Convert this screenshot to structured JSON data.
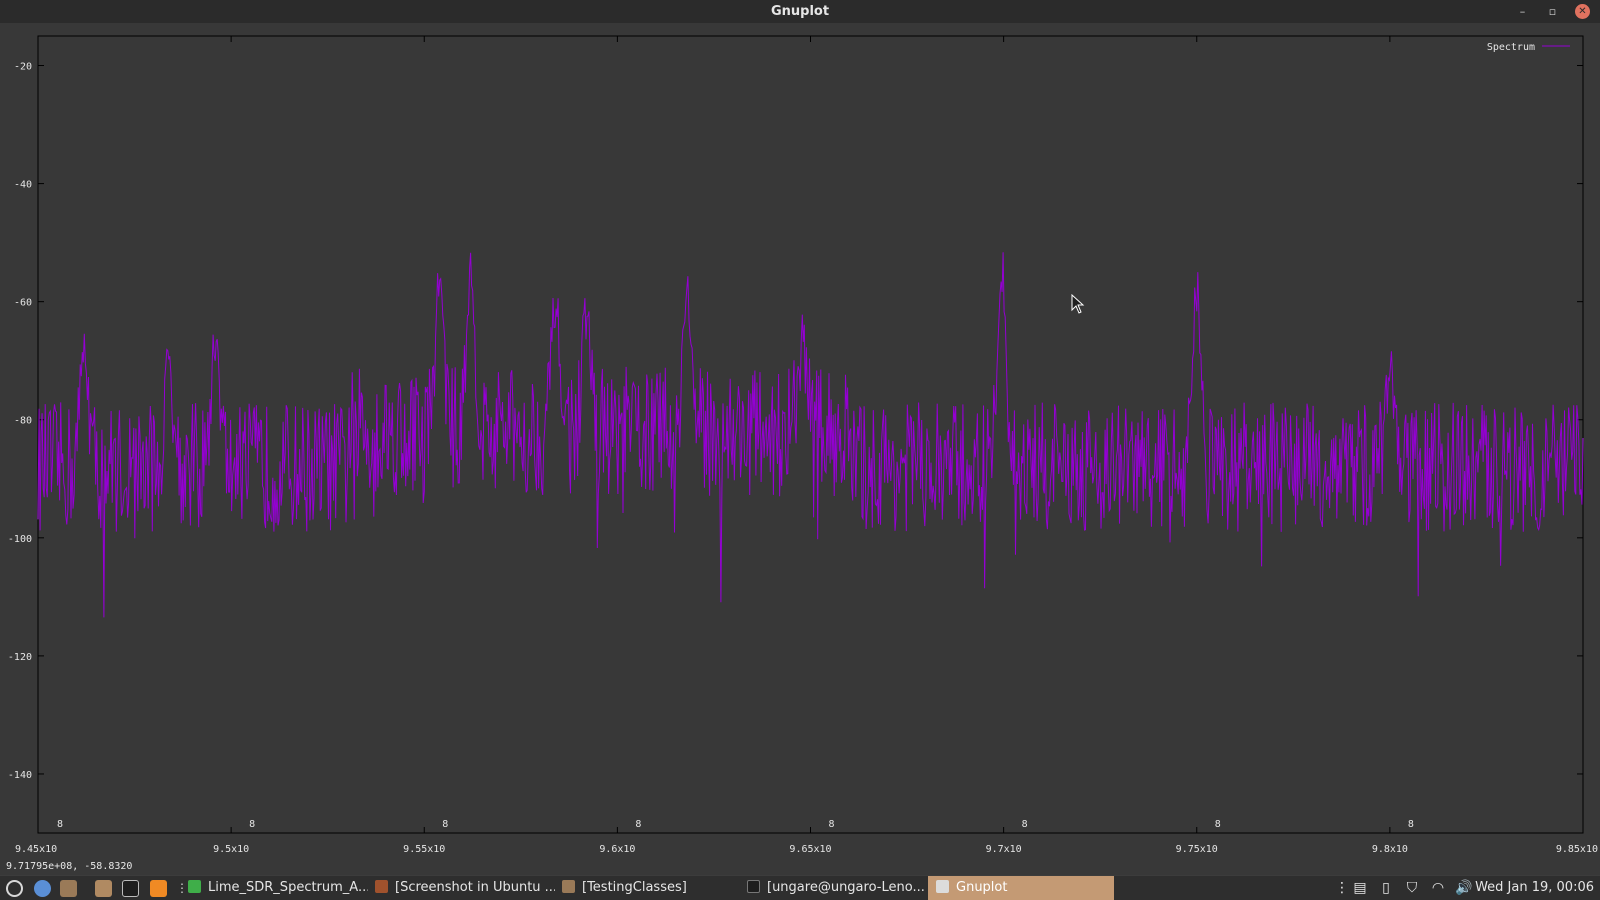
{
  "window": {
    "title": "Gnuplot"
  },
  "plot": {
    "y_ticks": [
      "-20",
      "-40",
      "-60",
      "-80",
      "-100",
      "-120",
      "-140"
    ],
    "x_ticks": [
      "9.45x10",
      "9.5x10",
      "9.55x10",
      "9.6x10",
      "9.65x10",
      "9.7x10",
      "9.75x10",
      "9.8x10",
      "9.85x10"
    ],
    "x_exponent": "8",
    "legend_label": "Spectrum",
    "series_color": "#9400d3",
    "status_text": "9.71795e+08, -58.8320"
  },
  "chart_data": {
    "type": "line",
    "legend": "top-right",
    "grid": false,
    "xlim": [
      945000000,
      985000000
    ],
    "ylim": [
      -150,
      -15
    ],
    "series": [
      {
        "name": "Spectrum",
        "color": "#9400d3",
        "noise_floor": -88,
        "peaks": [
          {
            "x": 946200000,
            "y": -68
          },
          {
            "x": 948400000,
            "y": -70
          },
          {
            "x": 949600000,
            "y": -66
          },
          {
            "x": 955400000,
            "y": -56
          },
          {
            "x": 956200000,
            "y": -56
          },
          {
            "x": 958400000,
            "y": -60
          },
          {
            "x": 959200000,
            "y": -62
          },
          {
            "x": 961800000,
            "y": -58
          },
          {
            "x": 964800000,
            "y": -67
          },
          {
            "x": 969950000,
            "y": -54
          },
          {
            "x": 975000000,
            "y": -58
          },
          {
            "x": 980000000,
            "y": -71
          }
        ]
      }
    ]
  },
  "taskbar": {
    "tasks": [
      "Lime_SDR_Spectrum_A...",
      "[Screenshot in Ubuntu ...",
      "[TestingClasses]",
      "[ungare@ungaro-Leno...",
      "Gnuplot"
    ],
    "clock": "Wed Jan 19, 00:06"
  }
}
